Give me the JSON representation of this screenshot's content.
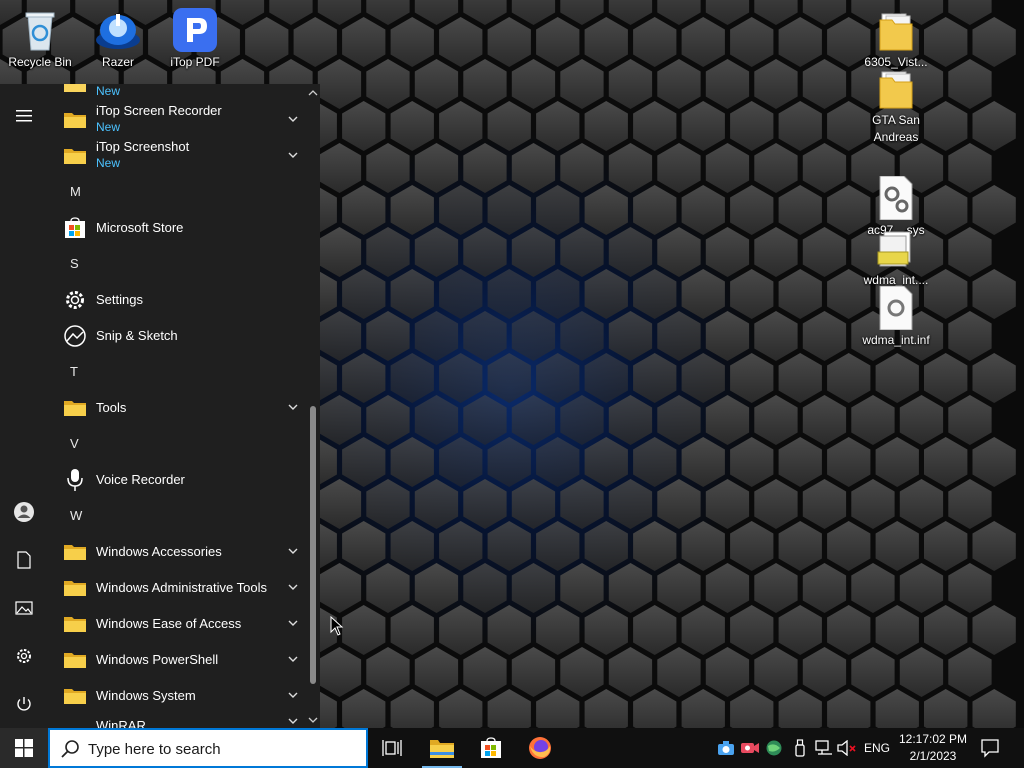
{
  "desktop": {
    "icons": [
      {
        "label": "Recycle Bin",
        "icon": "recycle-bin-icon"
      },
      {
        "label": "Razer",
        "icon": "razer-icon"
      },
      {
        "label": "iTop PDF",
        "icon": "itop-pdf-icon"
      },
      {
        "label": "6305_Vist...",
        "icon": "folder-icon"
      },
      {
        "label": "GTA San Andreas",
        "icon": "folder-icon"
      },
      {
        "label": "ac97....sys",
        "icon": "system-file-icon"
      },
      {
        "label": "wdma_int....",
        "icon": "setup-info-icon"
      },
      {
        "label": "wdma_int.inf",
        "icon": "system-file-icon"
      }
    ]
  },
  "start_menu": {
    "rail": [
      {
        "name": "menu-icon"
      },
      {
        "name": "user-account-icon"
      },
      {
        "name": "documents-icon"
      },
      {
        "name": "pictures-icon"
      },
      {
        "name": "settings-icon"
      },
      {
        "name": "power-icon"
      }
    ],
    "partial_top_new": "New",
    "items": {
      "itop_recorder": {
        "label": "iTop Screen Recorder",
        "badge": "New"
      },
      "itop_screenshot": {
        "label": "iTop Screenshot",
        "badge": "New"
      },
      "letter_m": "M",
      "ms_store": {
        "label": "Microsoft Store"
      },
      "letter_s": "S",
      "settings": {
        "label": "Settings"
      },
      "snip": {
        "label": "Snip & Sketch"
      },
      "letter_t": "T",
      "tools": {
        "label": "Tools"
      },
      "letter_v": "V",
      "voice": {
        "label": "Voice Recorder"
      },
      "letter_w": "W",
      "win_acc": {
        "label": "Windows Accessories"
      },
      "win_admin": {
        "label": "Windows Administrative Tools"
      },
      "win_ease": {
        "label": "Windows Ease of Access"
      },
      "win_ps": {
        "label": "Windows PowerShell"
      },
      "win_sys": {
        "label": "Windows System"
      },
      "winrar": {
        "label": "WinRAR"
      }
    }
  },
  "taskbar": {
    "search_placeholder": "Type here to search",
    "pinned": [
      "task-view-icon",
      "file-explorer-icon",
      "microsoft-store-icon",
      "firefox-icon"
    ],
    "tray": [
      "camera-icon",
      "recorder-icon",
      "network-globe-icon",
      "usb-icon",
      "network-icon",
      "volume-muted-icon"
    ],
    "language": "ENG",
    "time": "12:17:02 PM",
    "date": "2/1/2023"
  },
  "colors": {
    "accent": "#0078d7",
    "new_badge": "#4cc2ff",
    "menu_bg": "#1f1f1f",
    "taskbar_bg": "#101010"
  }
}
